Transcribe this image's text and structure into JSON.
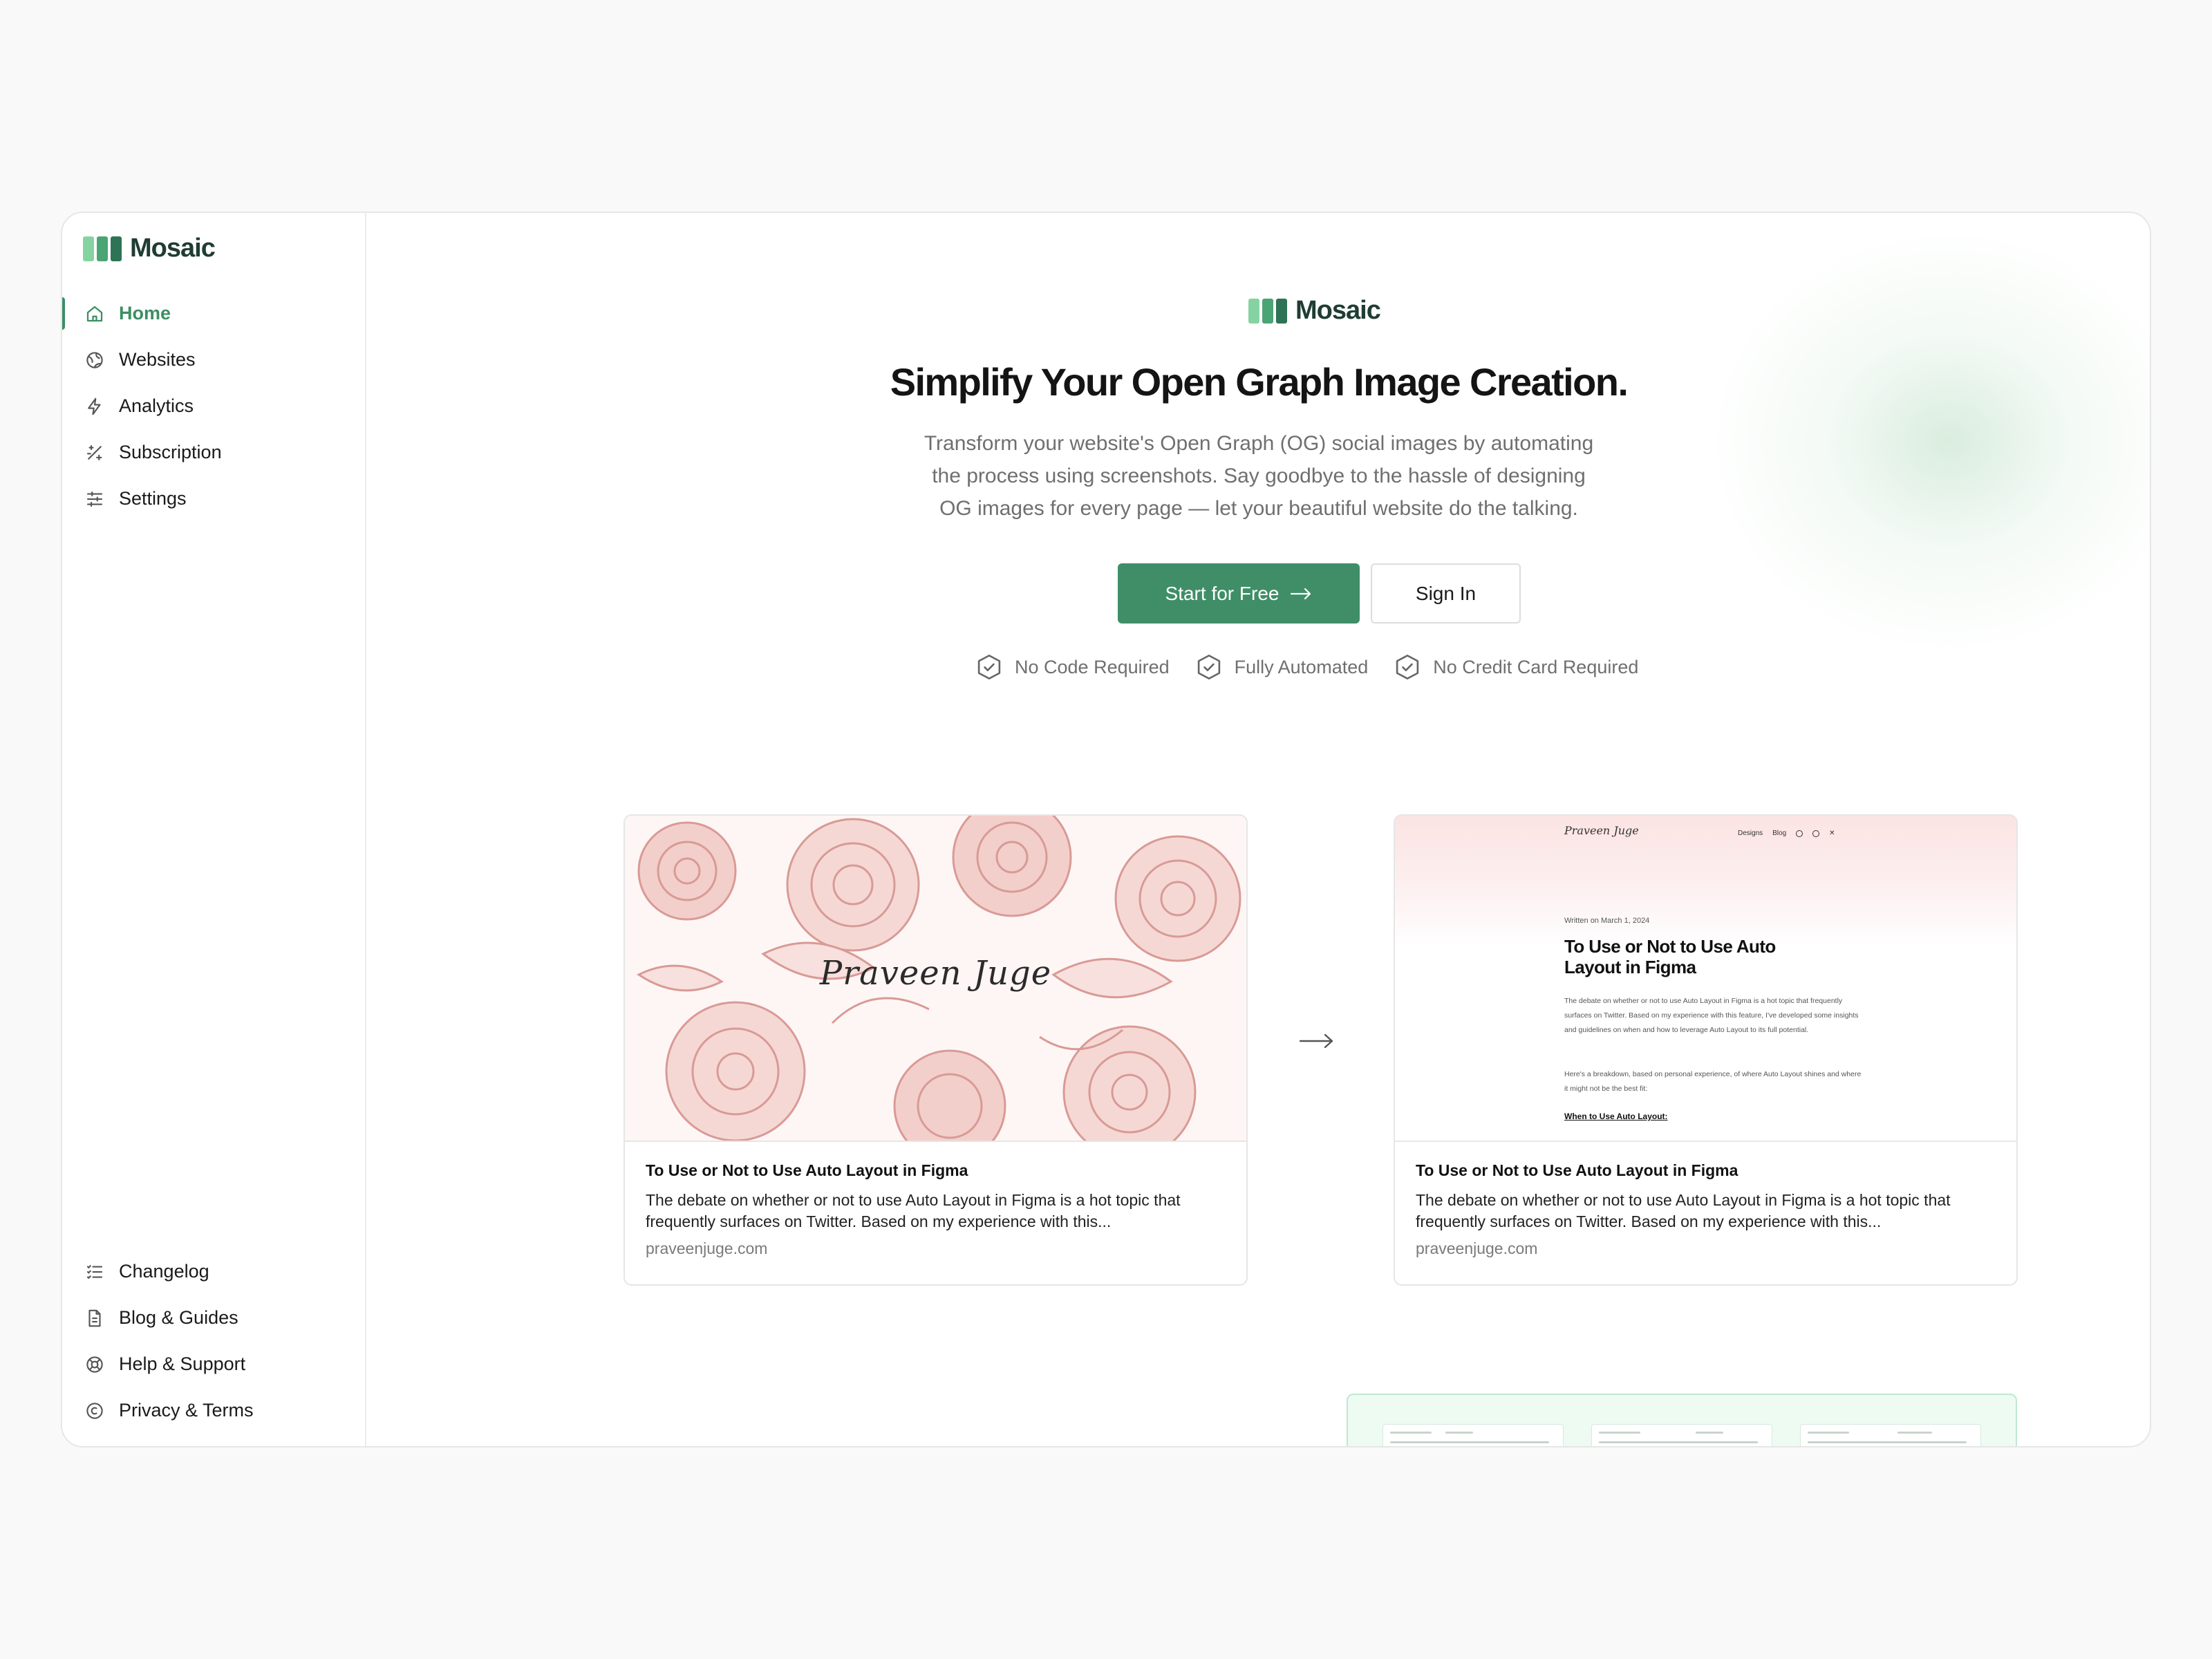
{
  "brand": {
    "name": "Mosaic",
    "colors": {
      "primary": "#3f8e67",
      "logo_light": "#7fcf9c",
      "logo_mid": "#3f8e67",
      "logo_dark": "#2a6a4d",
      "text_dark": "#1f3d33"
    }
  },
  "sidebar": {
    "items": [
      {
        "label": "Home",
        "icon": "home-icon",
        "active": true
      },
      {
        "label": "Websites",
        "icon": "globe-icon",
        "active": false
      },
      {
        "label": "Analytics",
        "icon": "lightning-icon",
        "active": false
      },
      {
        "label": "Subscription",
        "icon": "sparkle-icon",
        "active": false
      },
      {
        "label": "Settings",
        "icon": "sliders-icon",
        "active": false
      }
    ],
    "bottom_items": [
      {
        "label": "Changelog",
        "icon": "checklist-icon"
      },
      {
        "label": "Blog & Guides",
        "icon": "document-icon"
      },
      {
        "label": "Help & Support",
        "icon": "lifebuoy-icon"
      },
      {
        "label": "Privacy & Terms",
        "icon": "copyright-icon"
      }
    ]
  },
  "hero": {
    "title": "Simplify Your Open Graph Image Creation.",
    "subtitle": "Transform your website's Open Graph (OG) social images by automating the process using screenshots. Say goodbye to the hassle of designing OG images for every page — let your beautiful website do the talking.",
    "primary_button": "Start for Free",
    "secondary_button": "Sign In",
    "features": [
      "No Code Required",
      "Fully Automated",
      "No Credit Card Required"
    ]
  },
  "cards": [
    {
      "image": "floral-illustration",
      "image_signature": "Praveen Juge",
      "title": "To Use or Not to Use Auto Layout in Figma",
      "description": "The debate on whether or not to use Auto Layout in Figma is a hot topic that frequently surfaces on Twitter. Based on my experience with this...",
      "domain": "praveenjuge.com"
    },
    {
      "image": "page-screenshot",
      "title": "To Use or Not to Use Auto Layout in Figma",
      "description": "The debate on whether or not to use Auto Layout in Figma is a hot topic that frequently surfaces on Twitter. Based on my experience with this...",
      "domain": "praveenjuge.com"
    }
  ],
  "preview": {
    "signature": "Praveen Juge",
    "nav": [
      "Designs",
      "Blog"
    ],
    "date": "Written on March 1, 2024",
    "title": "To Use or Not to Use Auto Layout in Figma",
    "paragraph1": "The debate on whether or not to use Auto Layout in Figma is a hot topic that frequently surfaces on Twitter. Based on my experience with this feature, I've developed some insights and guidelines on when and how to leverage Auto Layout to its full potential.",
    "paragraph2": "Here's a breakdown, based on personal experience, of where Auto Layout shines and where it might not be the best fit:",
    "link": "When to Use Auto Layout:"
  }
}
